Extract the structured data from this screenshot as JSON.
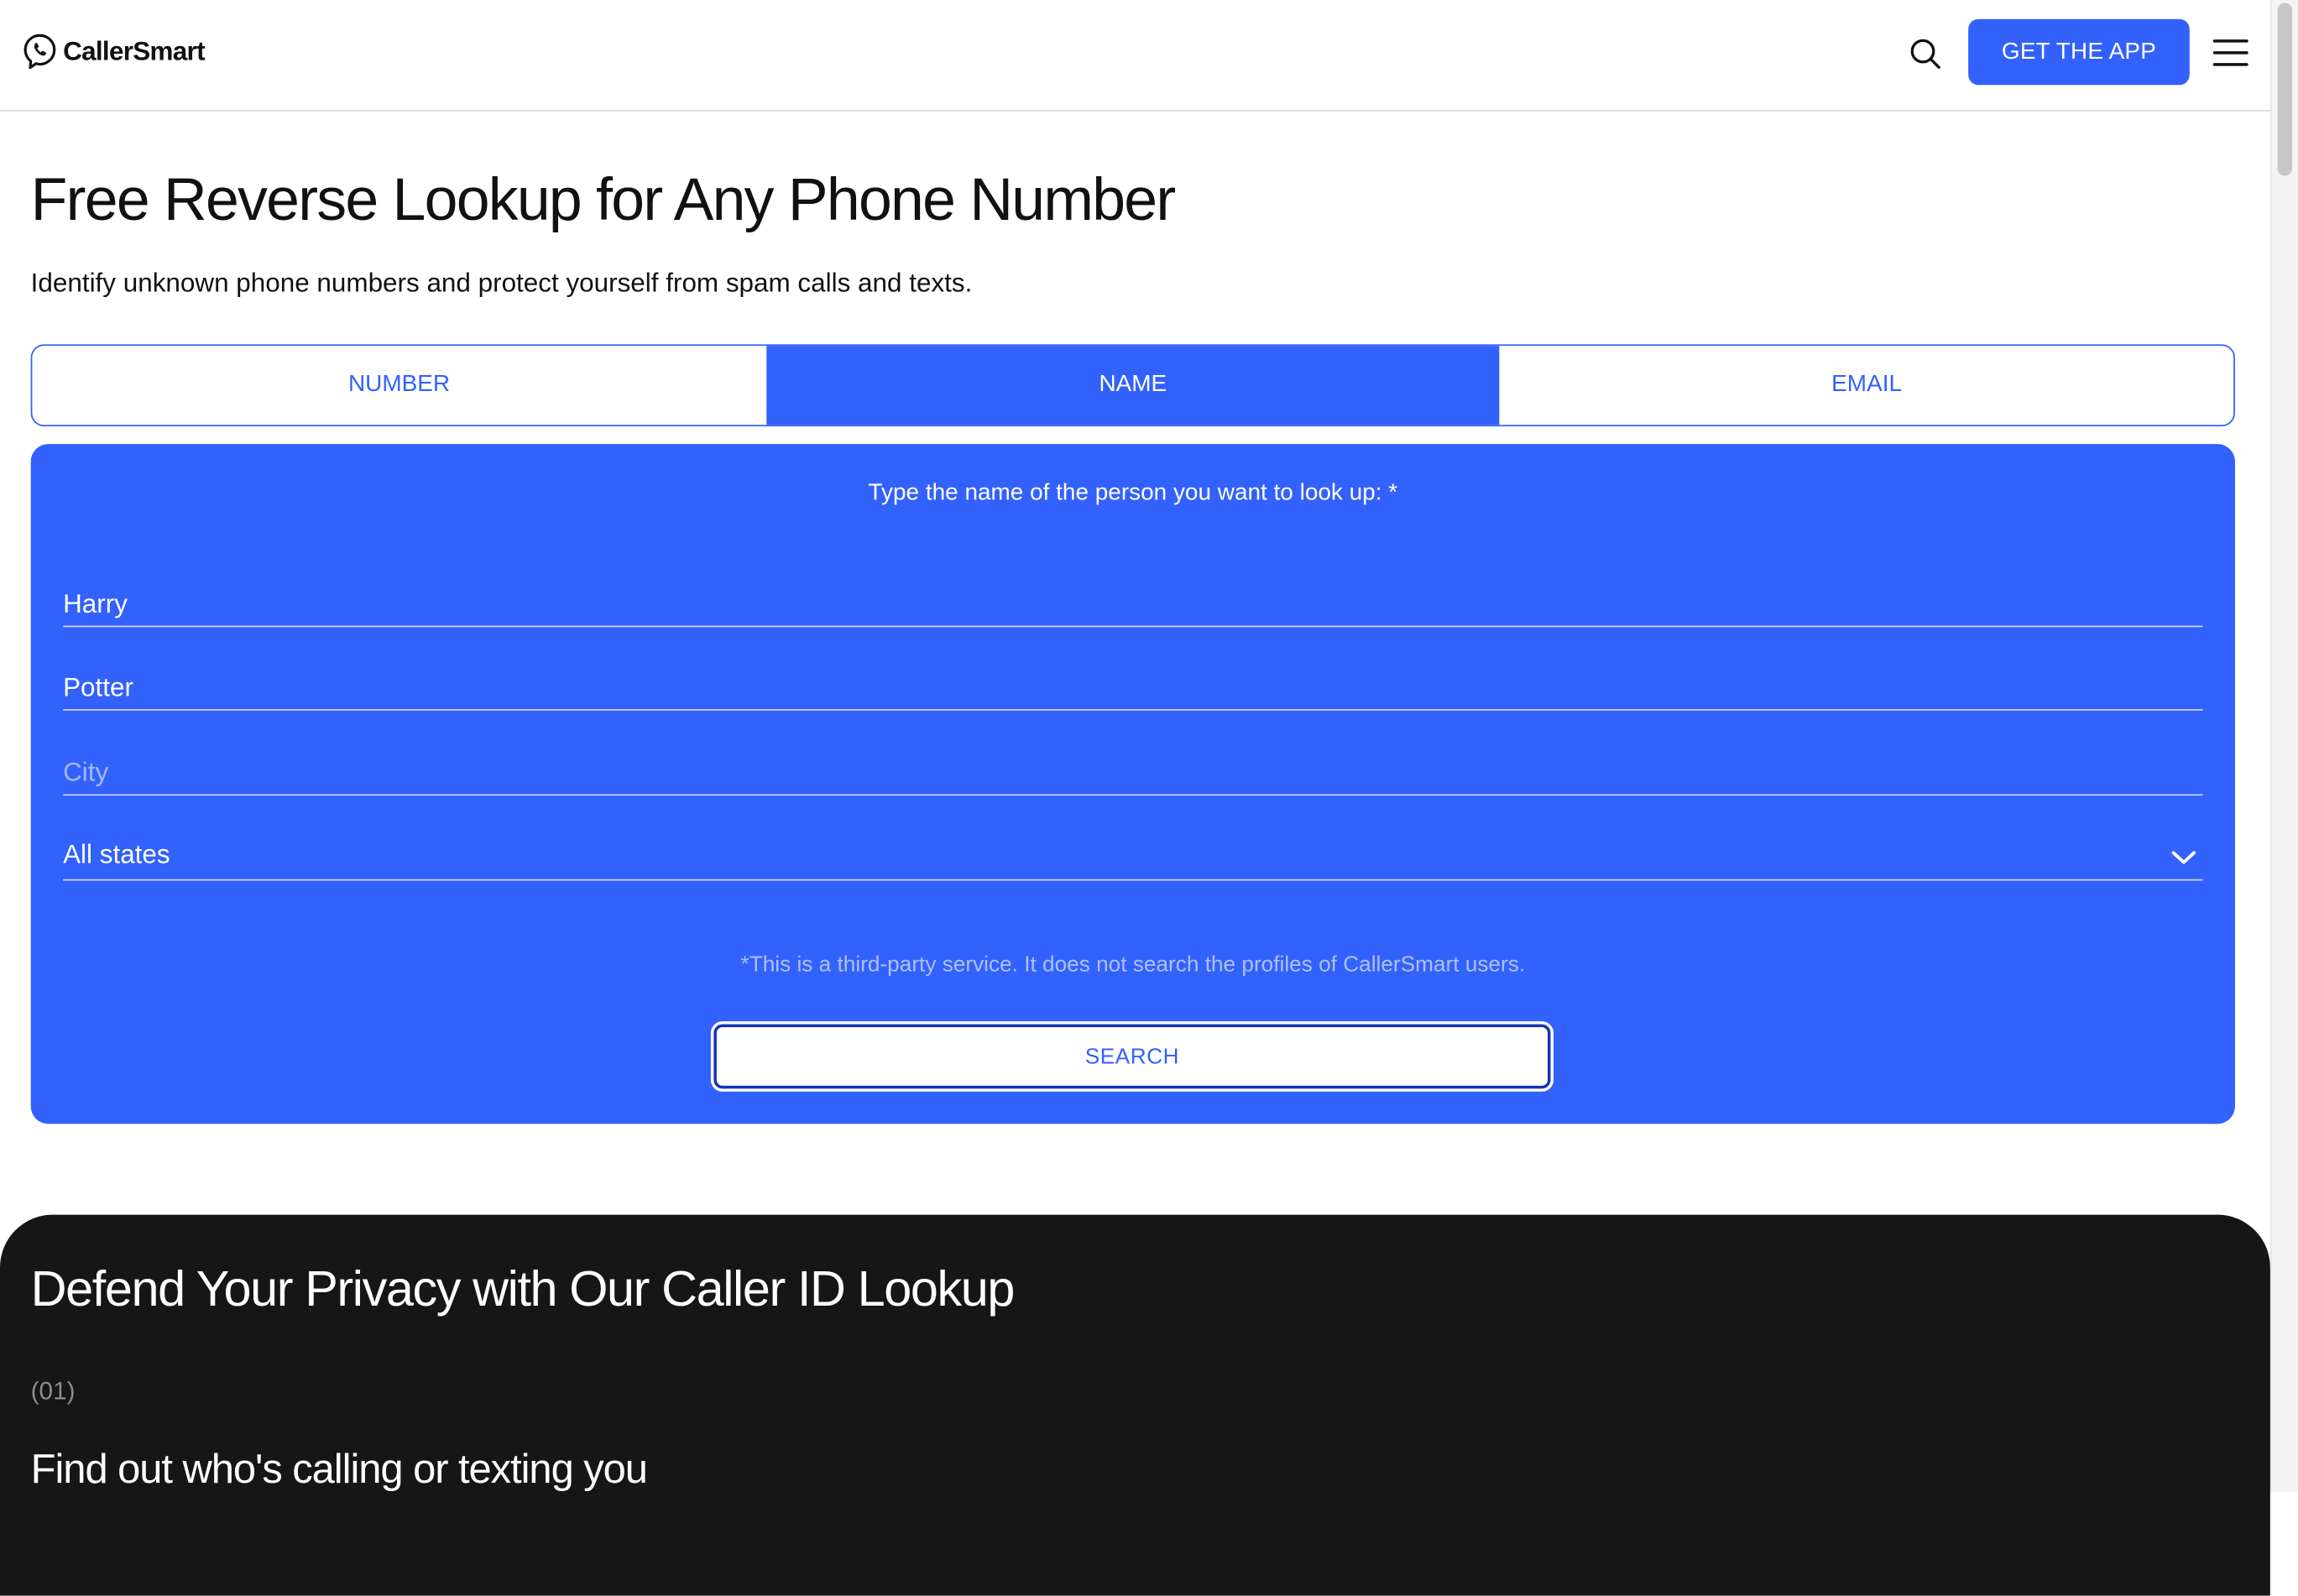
{
  "header": {
    "brand": "CallerSmart",
    "get_app_label": "GET THE APP",
    "icons": [
      "search-icon",
      "menu-icon"
    ]
  },
  "hero": {
    "title": "Free Reverse Lookup for Any Phone Number",
    "subtitle": "Identify unknown phone numbers and protect yourself from spam calls and texts."
  },
  "tabs": [
    {
      "label": "NUMBER",
      "active": false
    },
    {
      "label": "NAME",
      "active": true
    },
    {
      "label": "EMAIL",
      "active": false
    }
  ],
  "form": {
    "prompt": "Type the name of the person you want to look up: *",
    "first_name_value": "Harry",
    "last_name_value": "Potter",
    "city_placeholder": "City",
    "city_value": "",
    "state_selected": "All states",
    "disclaimer": "*This is a third-party service. It does not search the profiles of CallerSmart users.",
    "search_label": "SEARCH"
  },
  "privacy": {
    "title": "Defend Your Privacy with Our Caller ID Lookup",
    "index": "(01)",
    "subtitle": "Find out who's calling or texting you"
  },
  "colors": {
    "accent": "#3361fb",
    "dark": "#161616",
    "text": "#111111"
  }
}
